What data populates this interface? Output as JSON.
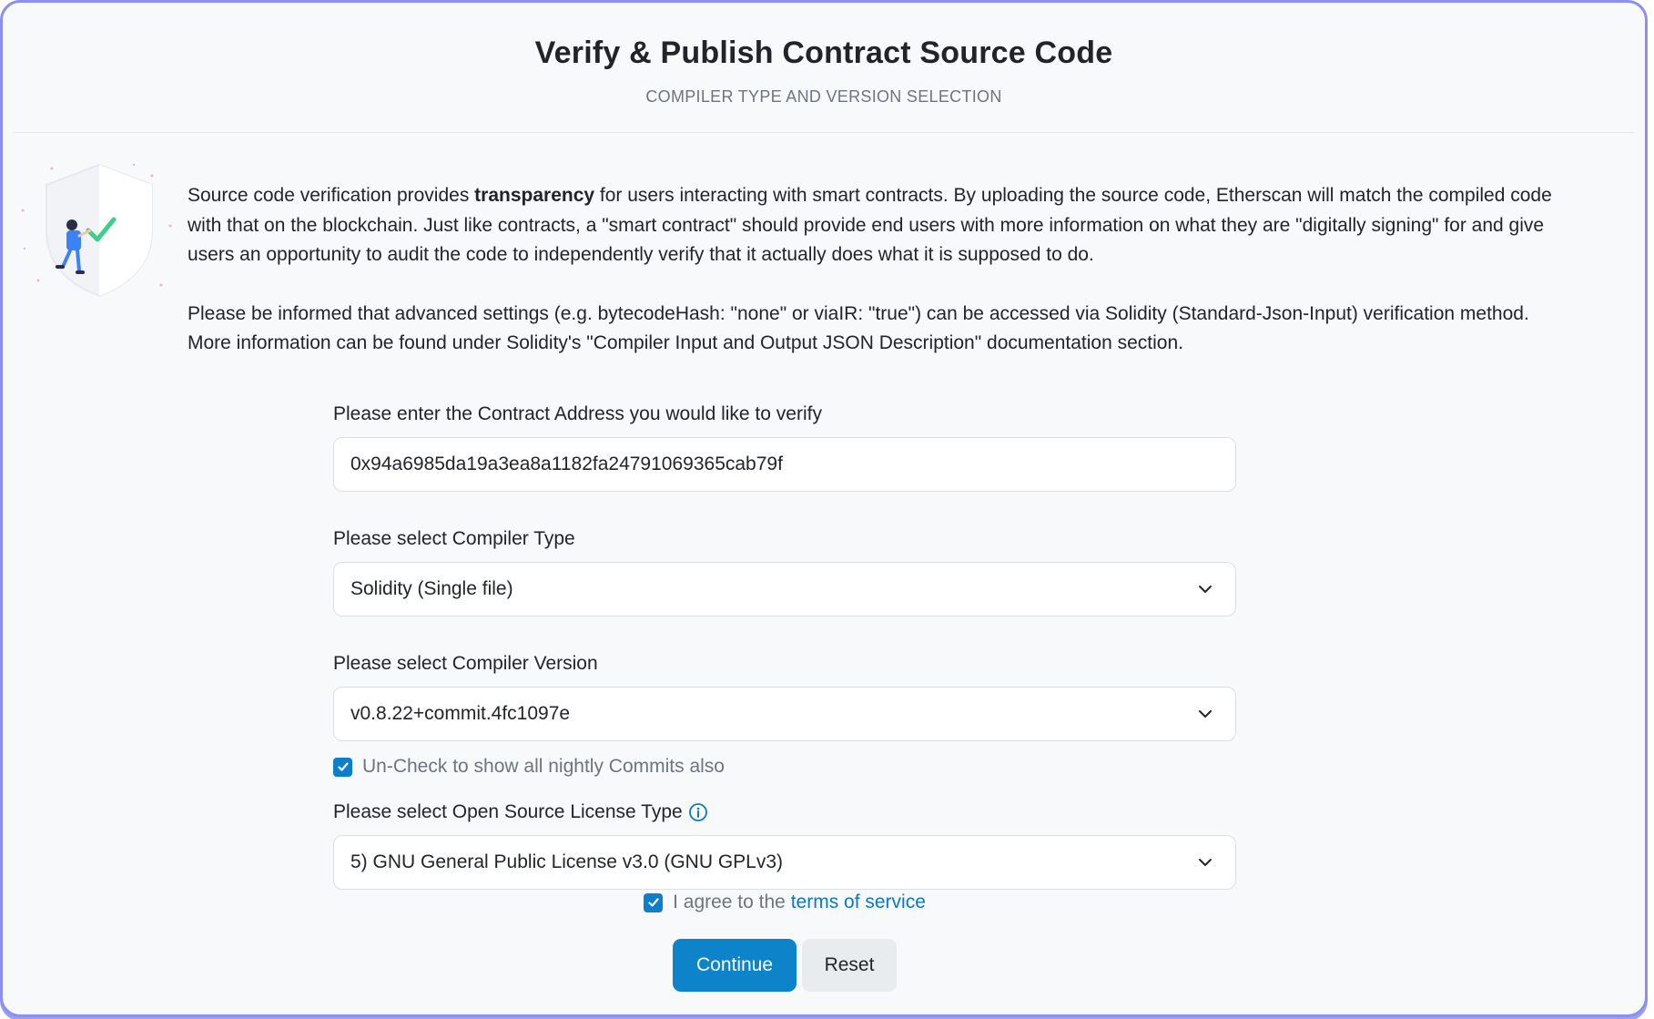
{
  "header": {
    "title": "Verify & Publish Contract Source Code",
    "subtitle": "COMPILER TYPE AND VERSION SELECTION"
  },
  "intro": {
    "p1_before": "Source code verification provides ",
    "p1_bold": "transparency",
    "p1_after": " for users interacting with smart contracts. By uploading the source code, Etherscan will match the compiled code with that on the blockchain. Just like contracts, a \"smart contract\" should provide end users with more information on what they are \"digitally signing\" for and give users an opportunity to audit the code to independently verify that it actually does what it is supposed to do.",
    "p2": "Please be informed that advanced settings (e.g. bytecodeHash: \"none\" or viaIR: \"true\") can be accessed via Solidity (Standard-Json-Input) verification method. More information can be found under Solidity's \"Compiler Input and Output JSON Description\" documentation section."
  },
  "form": {
    "address_label": "Please enter the Contract Address you would like to verify",
    "address_value": "0x94a6985da19a3ea8a1182fa24791069365cab79f",
    "compiler_type_label": "Please select Compiler Type",
    "compiler_type_value": "Solidity (Single file)",
    "compiler_version_label": "Please select Compiler Version",
    "compiler_version_value": "v0.8.22+commit.4fc1097e",
    "nightly_label": "Un-Check to show all nightly Commits also",
    "nightly_checked": true,
    "license_label": "Please select Open Source License Type",
    "license_value": "5) GNU General Public License v3.0 (GNU GPLv3)",
    "agree_prefix": "I agree to the ",
    "agree_link": "terms of service",
    "agree_checked": true
  },
  "buttons": {
    "continue": "Continue",
    "reset": "Reset"
  },
  "colors": {
    "primary": "#0d84c9",
    "link": "#0b79c1",
    "checkbox": "#0d7fc8",
    "frame_border": "#8a8ff0"
  },
  "icons": {
    "chevron": "chevron-down-icon",
    "info": "info-icon",
    "check": "check-icon",
    "illustration": "shield-checkmark-illustration"
  }
}
